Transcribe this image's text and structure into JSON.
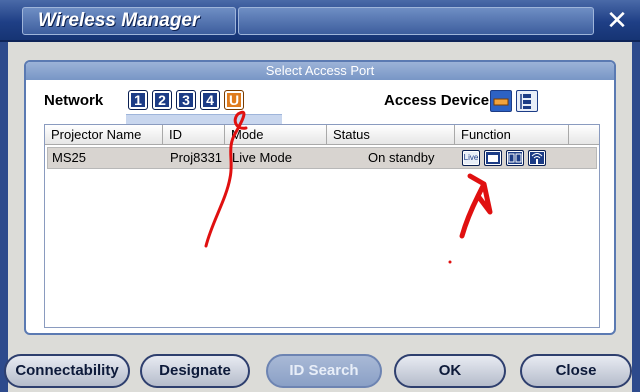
{
  "window": {
    "title": "Wireless Manager",
    "close_glyph": "✕"
  },
  "panel": {
    "header": "Select Access Port",
    "network_label": "Network",
    "network_buttons": [
      "1",
      "2",
      "3",
      "4",
      "U"
    ],
    "access_device_label": "Access Device",
    "access_icons": [
      "lan-icon",
      "wireless-icon"
    ]
  },
  "table": {
    "columns": [
      "Projector Name",
      "ID",
      "Mode",
      "Status",
      "Function"
    ],
    "rows": [
      {
        "projector_name": "MS25",
        "id": "Proj8331",
        "mode": "Live Mode",
        "status": "On standby",
        "function_icons": [
          "live-icon",
          "display-icon",
          "multi-live-icon",
          "wireless-signal-icon"
        ],
        "live_label": "Live"
      }
    ]
  },
  "buttons": {
    "connectability": "Connectability",
    "designate": "Designate",
    "id_search": "ID Search",
    "ok": "OK",
    "close": "Close"
  },
  "colors": {
    "title_bar": "#1f3f86",
    "accent": "#1c3c86",
    "u_button": "#e07c1e",
    "annotation": "#e01010"
  }
}
